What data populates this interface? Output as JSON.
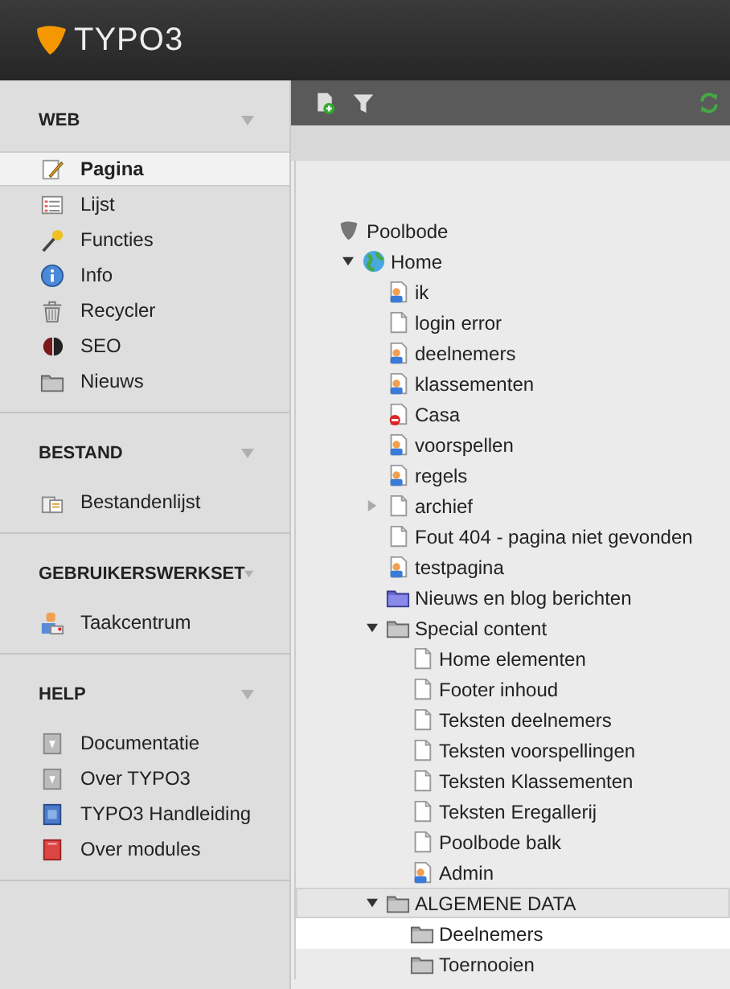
{
  "header": {
    "logo_text": "TYPO3"
  },
  "sidebar": {
    "sections": [
      {
        "title": "WEB",
        "items": [
          {
            "label": "Pagina",
            "kind": "page-edit",
            "selected": true
          },
          {
            "label": "Lijst",
            "kind": "list",
            "selected": false
          },
          {
            "label": "Functies",
            "kind": "wand",
            "selected": false
          },
          {
            "label": "Info",
            "kind": "info",
            "selected": false
          },
          {
            "label": "Recycler",
            "kind": "trash",
            "selected": false
          },
          {
            "label": "SEO",
            "kind": "seo",
            "selected": false
          },
          {
            "label": "Nieuws",
            "kind": "folder",
            "selected": false
          }
        ]
      },
      {
        "title": "BESTAND",
        "items": [
          {
            "label": "Bestandenlijst",
            "kind": "files",
            "selected": false
          }
        ]
      },
      {
        "title": "GEBRUIKERSWERKSET",
        "items": [
          {
            "label": "Taakcentrum",
            "kind": "user-task",
            "selected": false
          }
        ]
      },
      {
        "title": "HELP",
        "items": [
          {
            "label": "Documentatie",
            "kind": "doc",
            "selected": false
          },
          {
            "label": "Over TYPO3",
            "kind": "doc",
            "selected": false
          },
          {
            "label": "TYPO3 Handleiding",
            "kind": "manual",
            "selected": false
          },
          {
            "label": "Over modules",
            "kind": "book",
            "selected": false
          }
        ]
      }
    ]
  },
  "page_tree": {
    "nodes": [
      {
        "label": "Poolbode",
        "kind": "root",
        "selected": false,
        "hovered": false,
        "children": [
          {
            "label": "Home",
            "kind": "globe",
            "expanded": true,
            "selected": false,
            "hovered": false,
            "children": [
              {
                "label": "ik",
                "kind": "page-user",
                "selected": false,
                "hovered": false
              },
              {
                "label": "login error",
                "kind": "page",
                "selected": false,
                "hovered": false
              },
              {
                "label": "deelnemers",
                "kind": "page-user",
                "selected": false,
                "hovered": false
              },
              {
                "label": "klassementen",
                "kind": "page-user",
                "selected": false,
                "hovered": false
              },
              {
                "label": "Casa",
                "kind": "page-red",
                "selected": false,
                "hovered": false
              },
              {
                "label": "voorspellen",
                "kind": "page-user",
                "selected": false,
                "hovered": false
              },
              {
                "label": "regels",
                "kind": "page-user",
                "selected": false,
                "hovered": false
              },
              {
                "label": "archief",
                "kind": "page",
                "expanded": false,
                "selected": false,
                "hovered": false
              },
              {
                "label": "Fout 404 - pagina niet gevonden",
                "kind": "page",
                "selected": false,
                "hovered": false
              },
              {
                "label": "testpagina",
                "kind": "page-user",
                "selected": false,
                "hovered": false
              },
              {
                "label": "Nieuws en blog berichten",
                "kind": "folder-blue",
                "selected": false,
                "hovered": false
              },
              {
                "label": "Special content",
                "kind": "folder",
                "expanded": true,
                "selected": false,
                "hovered": false,
                "children": [
                  {
                    "label": "Home elementen",
                    "kind": "page",
                    "selected": false,
                    "hovered": false
                  },
                  {
                    "label": "Footer inhoud",
                    "kind": "page",
                    "selected": false,
                    "hovered": false
                  },
                  {
                    "label": "Teksten deelnemers",
                    "kind": "page",
                    "selected": false,
                    "hovered": false
                  },
                  {
                    "label": "Teksten voorspellingen",
                    "kind": "page",
                    "selected": false,
                    "hovered": false
                  },
                  {
                    "label": "Teksten Klassementen",
                    "kind": "page",
                    "selected": false,
                    "hovered": false
                  },
                  {
                    "label": "Teksten Eregallerij",
                    "kind": "page",
                    "selected": false,
                    "hovered": false
                  },
                  {
                    "label": "Poolbode balk",
                    "kind": "page",
                    "selected": false,
                    "hovered": false
                  },
                  {
                    "label": "Admin",
                    "kind": "page-user",
                    "selected": false,
                    "hovered": false
                  }
                ]
              },
              {
                "label": "ALGEMENE DATA",
                "kind": "folder",
                "expanded": true,
                "selected": true,
                "hovered": false,
                "children": [
                  {
                    "label": "Deelnemers",
                    "kind": "folder",
                    "selected": false,
                    "hovered": true
                  },
                  {
                    "label": "Toernooien",
                    "kind": "folder",
                    "selected": false,
                    "hovered": false
                  }
                ]
              }
            ]
          }
        ]
      }
    ]
  }
}
